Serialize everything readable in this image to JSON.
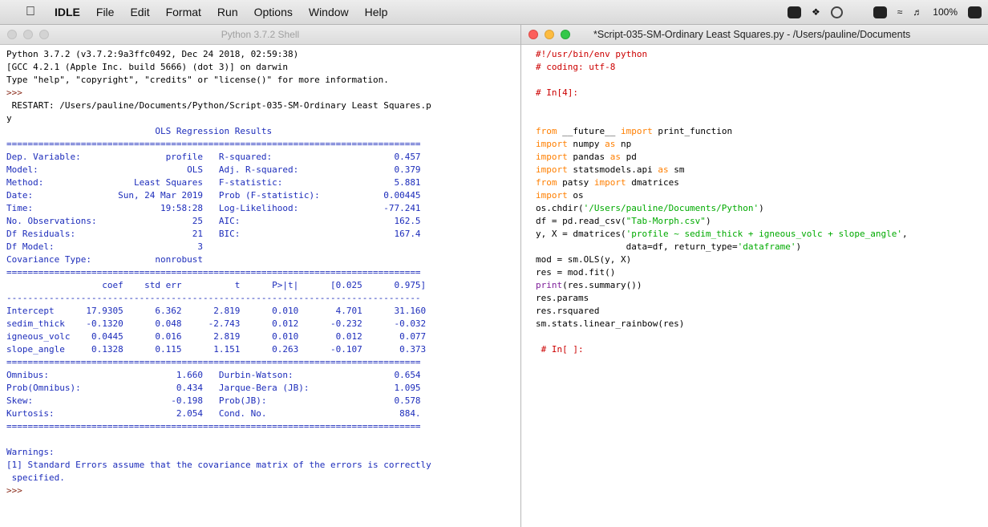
{
  "menubar": {
    "app_name": "IDLE",
    "items": [
      "File",
      "Edit",
      "Format",
      "Run",
      "Options",
      "Window",
      "Help"
    ],
    "battery": "100%"
  },
  "shell": {
    "title": "Python 3.7.2 Shell",
    "header": [
      "Python 3.7.2 (v3.7.2:9a3ffc0492, Dec 24 2018, 02:59:38)",
      "[GCC 4.2.1 (Apple Inc. build 5666) (dot 3)] on darwin",
      "Type \"help\", \"copyright\", \"credits\" or \"license()\" for more information."
    ],
    "prompt": ">>>",
    "restart_lines": [
      " RESTART: /Users/pauline/Documents/Python/Script-035-SM-Ordinary Least Squares.p",
      "y"
    ],
    "summary": [
      "                            OLS Regression Results                            ",
      "==============================================================================",
      "Dep. Variable:                profile   R-squared:                       0.457",
      "Model:                            OLS   Adj. R-squared:                  0.379",
      "Method:                 Least Squares   F-statistic:                     5.881",
      "Date:                Sun, 24 Mar 2019   Prob (F-statistic):            0.00445",
      "Time:                        19:58:28   Log-Likelihood:                -77.241",
      "No. Observations:                  25   AIC:                             162.5",
      "Df Residuals:                      21   BIC:                             167.4",
      "Df Model:                           3                                         ",
      "Covariance Type:            nonrobust                                         ",
      "==============================================================================",
      "                  coef    std err          t      P>|t|      [0.025      0.975]",
      "------------------------------------------------------------------------------",
      "Intercept      17.9305      6.362      2.819      0.010       4.701      31.160",
      "sedim_thick    -0.1320      0.048     -2.743      0.012      -0.232      -0.032",
      "igneous_volc    0.0445      0.016      2.819      0.010       0.012       0.077",
      "slope_angle     0.1328      0.115      1.151      0.263      -0.107       0.373",
      "==============================================================================",
      "Omnibus:                        1.660   Durbin-Watson:                   0.654",
      "Prob(Omnibus):                  0.434   Jarque-Bera (JB):                1.095",
      "Skew:                          -0.198   Prob(JB):                        0.578",
      "Kurtosis:                       2.054   Cond. No.                         884.",
      "==============================================================================",
      "",
      "Warnings:",
      "[1] Standard Errors assume that the covariance matrix of the errors is correctly",
      " specified."
    ]
  },
  "editor": {
    "title": "*Script-035-SM-Ordinary Least Squares.py - /Users/pauline/Documents",
    "lines": [
      [
        [
          "#!/usr/bin/env python",
          "red"
        ]
      ],
      [
        [
          "# coding: utf-8",
          "red"
        ]
      ],
      [
        [
          "",
          "black"
        ]
      ],
      [
        [
          "# In[4]:",
          "red"
        ]
      ],
      [
        [
          "",
          "black"
        ]
      ],
      [
        [
          "",
          "black"
        ]
      ],
      [
        [
          "from",
          "orange"
        ],
        [
          " __future__ ",
          "black"
        ],
        [
          "import",
          "orange"
        ],
        [
          " print_function",
          "black"
        ]
      ],
      [
        [
          "import",
          "orange"
        ],
        [
          " numpy ",
          "black"
        ],
        [
          "as",
          "orange"
        ],
        [
          " np",
          "black"
        ]
      ],
      [
        [
          "import",
          "orange"
        ],
        [
          " pandas ",
          "black"
        ],
        [
          "as",
          "orange"
        ],
        [
          " pd",
          "black"
        ]
      ],
      [
        [
          "import",
          "orange"
        ],
        [
          " statsmodels.api ",
          "black"
        ],
        [
          "as",
          "orange"
        ],
        [
          " sm",
          "black"
        ]
      ],
      [
        [
          "from",
          "orange"
        ],
        [
          " patsy ",
          "black"
        ],
        [
          "import",
          "orange"
        ],
        [
          " dmatrices",
          "black"
        ]
      ],
      [
        [
          "import",
          "orange"
        ],
        [
          " os",
          "black"
        ]
      ],
      [
        [
          "os.chdir(",
          "black"
        ],
        [
          "'/Users/pauline/Documents/Python'",
          "green"
        ],
        [
          ")",
          "black"
        ]
      ],
      [
        [
          "df = pd.read_csv(",
          "black"
        ],
        [
          "\"Tab-Morph.csv\"",
          "green"
        ],
        [
          ")",
          "black"
        ]
      ],
      [
        [
          "y, X = dmatrices(",
          "black"
        ],
        [
          "'profile ~ sedim_thick + igneous_volc + slope_angle'",
          "green"
        ],
        [
          ",",
          "black"
        ]
      ],
      [
        [
          "                 data=df, return_type=",
          "black"
        ],
        [
          "'dataframe'",
          "green"
        ],
        [
          ")",
          "black"
        ]
      ],
      [
        [
          "mod = sm.OLS(y, X)",
          "black"
        ]
      ],
      [
        [
          "res = mod.fit()",
          "black"
        ]
      ],
      [
        [
          "print",
          "purple"
        ],
        [
          "(res.summary())",
          "black"
        ]
      ],
      [
        [
          "res.params",
          "black"
        ]
      ],
      [
        [
          "res.rsquared",
          "black"
        ]
      ],
      [
        [
          "sm.stats.linear_rainbow(res)",
          "black"
        ]
      ],
      [
        [
          "",
          "black"
        ]
      ],
      [
        [
          " # In[ ]:",
          "red"
        ]
      ]
    ]
  }
}
